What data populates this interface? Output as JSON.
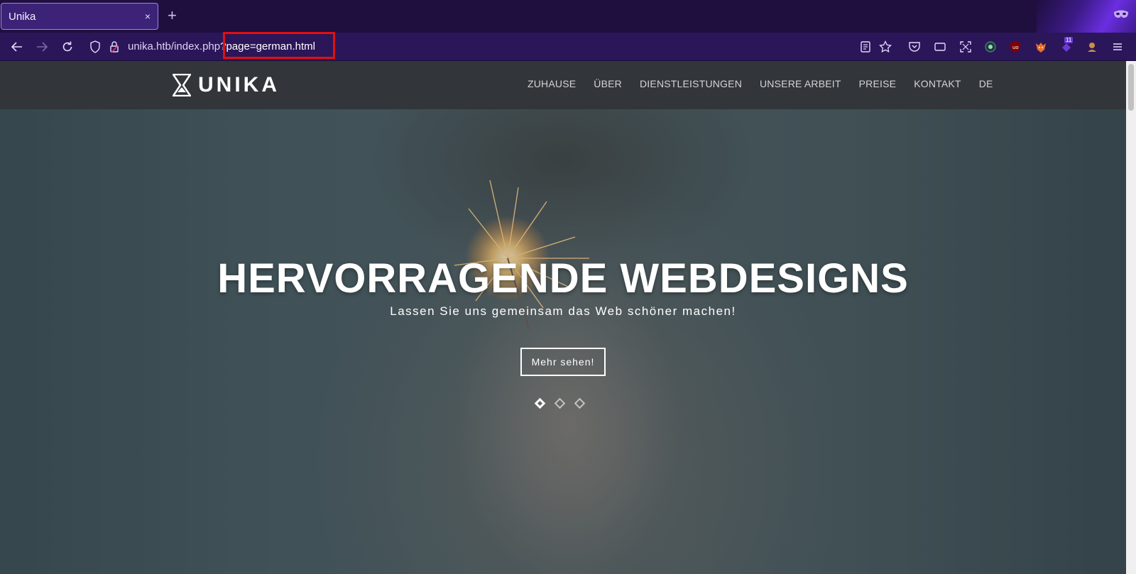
{
  "browser": {
    "tab_title": "Unika",
    "tab_close": "×",
    "new_tab": "+",
    "url_host": "unika.htb/index.php",
    "url_query": "?page=german.html",
    "extension_badge": "11"
  },
  "site": {
    "logo_text": "UNIKA",
    "nav": [
      "ZUHAUSE",
      "ÜBER",
      "DIENSTLEISTUNGEN",
      "UNSERE ARBEIT",
      "PREISE",
      "KONTAKT",
      "DE"
    ]
  },
  "hero": {
    "title": "HERVORRAGENDE WEBDESIGNS",
    "subtitle": "Lassen Sie uns gemeinsam das Web schöner machen!",
    "button": "Mehr sehen!",
    "slide_count": 3,
    "active_slide": 1
  },
  "icons": {
    "private_browsing": "private-mask-icon",
    "shield": "tracking-protection-icon",
    "lock": "lock-icon",
    "reader": "reader-view-icon",
    "star": "bookmark-star-icon",
    "extensions": [
      "pocket-icon",
      "screen-icon",
      "screenshot-icon",
      "wappalyzer-icon",
      "ublock-icon",
      "foxyproxy-icon",
      "extension-badge-icon",
      "cookie-icon"
    ],
    "menu": "hamburger-menu-icon"
  },
  "colors": {
    "chrome_bg": "#1f0f3e",
    "navbar_bg": "#2b1659",
    "site_header_bg": "#323539",
    "highlight": "#e01010"
  }
}
